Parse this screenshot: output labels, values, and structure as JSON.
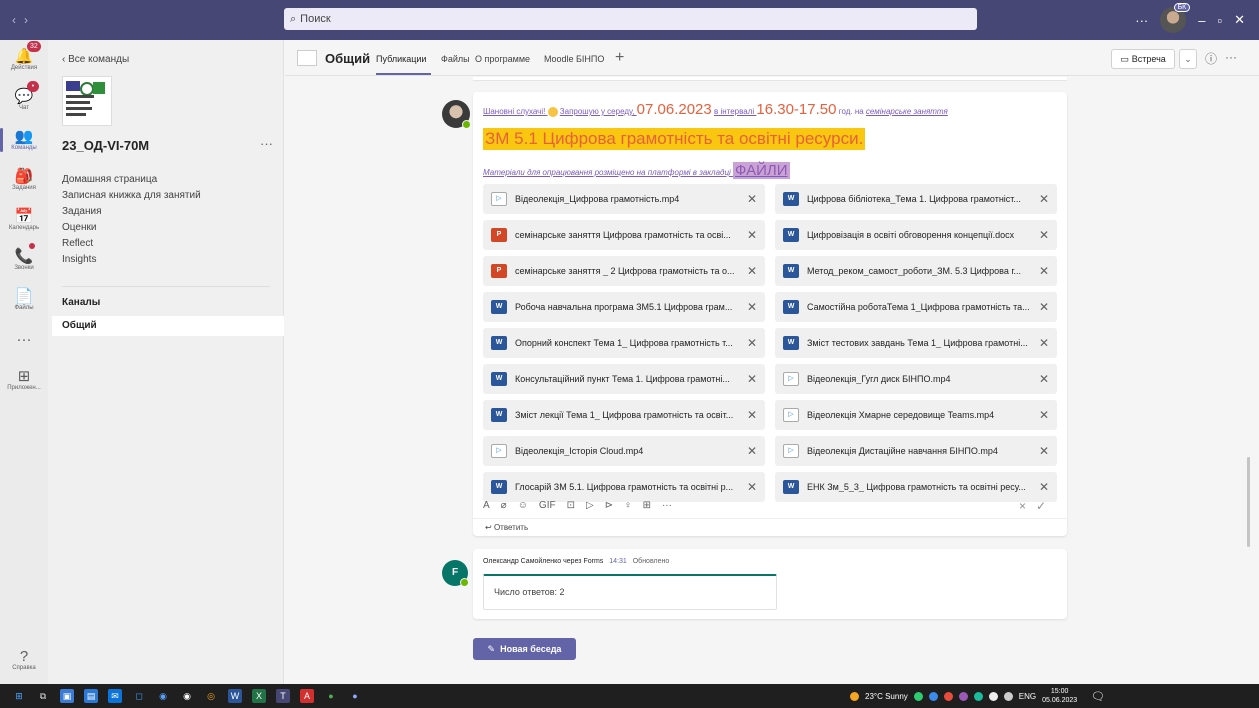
{
  "titlebar": {
    "search_placeholder": "Поиск",
    "profile_badge": "БК"
  },
  "rail": [
    {
      "name": "activity",
      "label": "Действия",
      "icon": "🔔",
      "badge": "32"
    },
    {
      "name": "chat",
      "label": "Чат",
      "icon": "💬",
      "badge": "•"
    },
    {
      "name": "teams",
      "label": "Команды",
      "icon": "👥",
      "active": true
    },
    {
      "name": "assignments",
      "label": "Задания",
      "icon": "🎒"
    },
    {
      "name": "calendar",
      "label": "Календарь",
      "icon": "📅"
    },
    {
      "name": "calls",
      "label": "Звонки",
      "icon": "📞"
    },
    {
      "name": "files",
      "label": "Файлы",
      "icon": "📄"
    },
    {
      "name": "more",
      "label": "",
      "icon": "···"
    },
    {
      "name": "apps",
      "label": "Приложен...",
      "icon": "⊞"
    }
  ],
  "rail_help": {
    "label": "Справка",
    "icon": "?"
  },
  "team_panel": {
    "back_label": "Все команды",
    "team_name": "23_ОД-VI-70М",
    "more": "···",
    "links": [
      "Домашняя страница",
      "Записная книжка для занятий",
      "Задания",
      "Оценки",
      "Reflect",
      "Insights"
    ],
    "channels_title": "Каналы",
    "channel_general": "Общий"
  },
  "channel_header": {
    "title": "Общий",
    "tabs": [
      "Публикации",
      "Файлы",
      "О программе",
      "Moodle БІНПО"
    ],
    "add_tab": "+",
    "meet_label": "Встреча",
    "meet_caret": "⌄",
    "info_icon": "ⓘ",
    "more_icon": "···"
  },
  "post": {
    "line1_a": "Шановні слухачі! ",
    "line1_b": "Запрошую у середу, ",
    "date": "07.06.2023",
    "line1_c": " в інтервалі ",
    "time": "16.30-17.50",
    "line1_d": " год. на ",
    "line1_e": "семінарське заняття",
    "heading": "ЗМ 5.1 Цифрова грамотність та освітні ресурси.",
    "line3": "Матеріали для опрацювання розміщено на платформі в закладці ",
    "files_word": "ФАЙЛИ",
    "attachments": [
      {
        "type": "video",
        "name": "Відеолекція_Цифрова грамотність.mp4"
      },
      {
        "type": "word",
        "name": "Цифрова бібліотека_Тема 1. Цифрова грамотніст..."
      },
      {
        "type": "ppt",
        "name": "семінарське заняття Цифрова грамотність та осві..."
      },
      {
        "type": "word",
        "name": "Цифровізація в освіті обговорення концепції.docx"
      },
      {
        "type": "ppt",
        "name": "семінарське заняття _ 2 Цифрова грамотність та о..."
      },
      {
        "type": "word",
        "name": "Метод_реком_самост_роботи_ЗМ. 5.3 Цифрова г..."
      },
      {
        "type": "word",
        "name": "Робоча навчальна програма ЗМ5.1 Цифрова грам..."
      },
      {
        "type": "word",
        "name": "Самостійна роботаТема 1_Цифрова грамотність та..."
      },
      {
        "type": "word",
        "name": "Опорний конспект Тема 1_ Цифрова грамотність т..."
      },
      {
        "type": "word",
        "name": "Зміст тестових завдань Тема 1_ Цифрова грамотні..."
      },
      {
        "type": "word",
        "name": "Консультаційний пункт Тема 1. Цифрова грамотні..."
      },
      {
        "type": "video",
        "name": "Відеолекція_Гугл диск БІНПО.mp4"
      },
      {
        "type": "word",
        "name": "Зміст лекції Тема 1_ Цифрова грамотність та освіт..."
      },
      {
        "type": "video",
        "name": "Відеолекція Хмарне середовище Teams.mp4"
      },
      {
        "type": "video",
        "name": "Відеолекція_Історія Cloud.mp4"
      },
      {
        "type": "video",
        "name": "Відеолекція Дистаційне навчання БІНПО.mp4"
      },
      {
        "type": "word",
        "name": "Глосарій ЗМ 5.1. Цифрова грамотність та освітні р..."
      },
      {
        "type": "word",
        "name": "ЕНК Зм_5_3_ Цифрова грамотність та освітні ресу..."
      }
    ],
    "format_icons": [
      "format-icon",
      "attach-icon",
      "emoji-icon",
      "gif-icon",
      "sticker-icon",
      "meet-now-icon",
      "stream-icon",
      "praise-icon",
      "forms-icon",
      "more-icon"
    ],
    "format_glyphs": [
      "A",
      "⌀",
      "☺",
      "GIF",
      "⊡",
      "▷",
      "⊳",
      "♀",
      "⊞",
      "···"
    ],
    "discard": "×",
    "send": "✓",
    "reply_label": "Ответить"
  },
  "forms_post": {
    "author": "Олександр Самойленко через Forms",
    "time": "14:31",
    "status": "Обновлено",
    "avatar": "F",
    "answers": "Число ответов: 2"
  },
  "new_conversation": "Новая беседа",
  "taskbar": {
    "weather": "23°C  Sunny",
    "lang": "ENG",
    "time": "15:00",
    "date": "05.06.2023"
  },
  "colors": {
    "titlebar": "#464775",
    "accent": "#6264a7",
    "highlight_yellow": "#f9c710",
    "highlight_purple": "#c9a2d6",
    "orange_text": "#e8603c"
  }
}
